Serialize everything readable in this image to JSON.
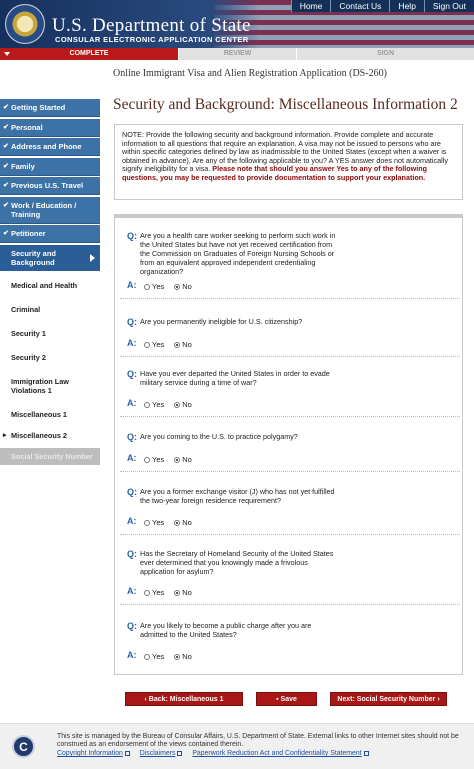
{
  "header": {
    "title": "U.S. Department of State",
    "subtitle": "CONSULAR ELECTRONIC APPLICATION CENTER",
    "nav": [
      "Home",
      "Contact Us",
      "Help",
      "Sign Out"
    ]
  },
  "progress": {
    "steps": [
      "COMPLETE",
      "REVIEW",
      "SIGN"
    ],
    "current": "COMPLETE"
  },
  "app_title": "Online Immigrant Visa and Alien Registration Application (DS-260)",
  "sidebar": {
    "items": [
      {
        "label": "Getting Started",
        "state": "done"
      },
      {
        "label": "Personal",
        "state": "done"
      },
      {
        "label": "Address and Phone",
        "state": "done"
      },
      {
        "label": "Family",
        "state": "done"
      },
      {
        "label": "Previous U.S. Travel",
        "state": "done"
      },
      {
        "label": "Work / Education / Training",
        "state": "done"
      },
      {
        "label": "Petitioner",
        "state": "done"
      },
      {
        "label": "Security and Background",
        "state": "current"
      },
      {
        "label": "Medical and Health",
        "state": "sub"
      },
      {
        "label": "Criminal",
        "state": "sub"
      },
      {
        "label": "Security 1",
        "state": "sub"
      },
      {
        "label": "Security 2",
        "state": "sub"
      },
      {
        "label": "Immigration Law Violations 1",
        "state": "sub"
      },
      {
        "label": "Miscellaneous 1",
        "state": "sub"
      },
      {
        "label": "Miscellaneous 2",
        "state": "active"
      },
      {
        "label": "Social Security Number",
        "state": "disabled"
      }
    ]
  },
  "page_title": "Security and Background: Miscellaneous Information 2",
  "note": {
    "text": "NOTE: Provide the following security and background information. Provide complete and accurate information to all questions that require an explanation. A visa may not be issued to persons who are within specific categories defined by law as inadmissible to the United States (except when a waiver is obtained in advance). Are any of the following applicable to you? A YES answer does not automatically signify ineligibility for a visa. ",
    "emphasis": "Please note that should you answer Yes to any of the following questions, you may be requested to provide documentation to support your explanation."
  },
  "labels": {
    "q": "Q:",
    "a": "A:",
    "yes": "Yes",
    "no": "No"
  },
  "questions": [
    {
      "text": "Are you a health care worker seeking to perform such work in the United States but have not yet received certification from the Commission on Graduates of Foreign Nursing Schools or from an equivalent approved independent credentialing organization?",
      "answer": "No"
    },
    {
      "text": "Are you permanently ineligible for U.S. citizenship?",
      "answer": "No"
    },
    {
      "text": "Have you ever departed the United States in order to evade military service during a time of war?",
      "answer": "No"
    },
    {
      "text": "Are you coming to the U.S. to practice polygamy?",
      "answer": "No"
    },
    {
      "text": "Are you a former exchange visitor (J) who has not yet fulfilled the two-year foreign residence requirement?",
      "answer": "No"
    },
    {
      "text": "Has the Secretary of Homeland Security of the United States ever determined that you knowingly made a frivolous application for asylum?",
      "answer": "No"
    },
    {
      "text": "Are you likely to become a public charge after you are admitted to the United States?",
      "answer": "No"
    }
  ],
  "buttons": {
    "back": "Back: Miscellaneous 1",
    "save": "Save",
    "next": "Next: Social Security Number"
  },
  "footer": {
    "text": "This site is managed by the Bureau of Consular Affairs, U.S. Department of State. External links to other Internet sites should not be construed as an endorsement of the views contained therein.",
    "links": [
      "Copyright Information",
      "Disclaimers",
      "Paperwork Reduction Act and Confidentiality Statement"
    ]
  }
}
